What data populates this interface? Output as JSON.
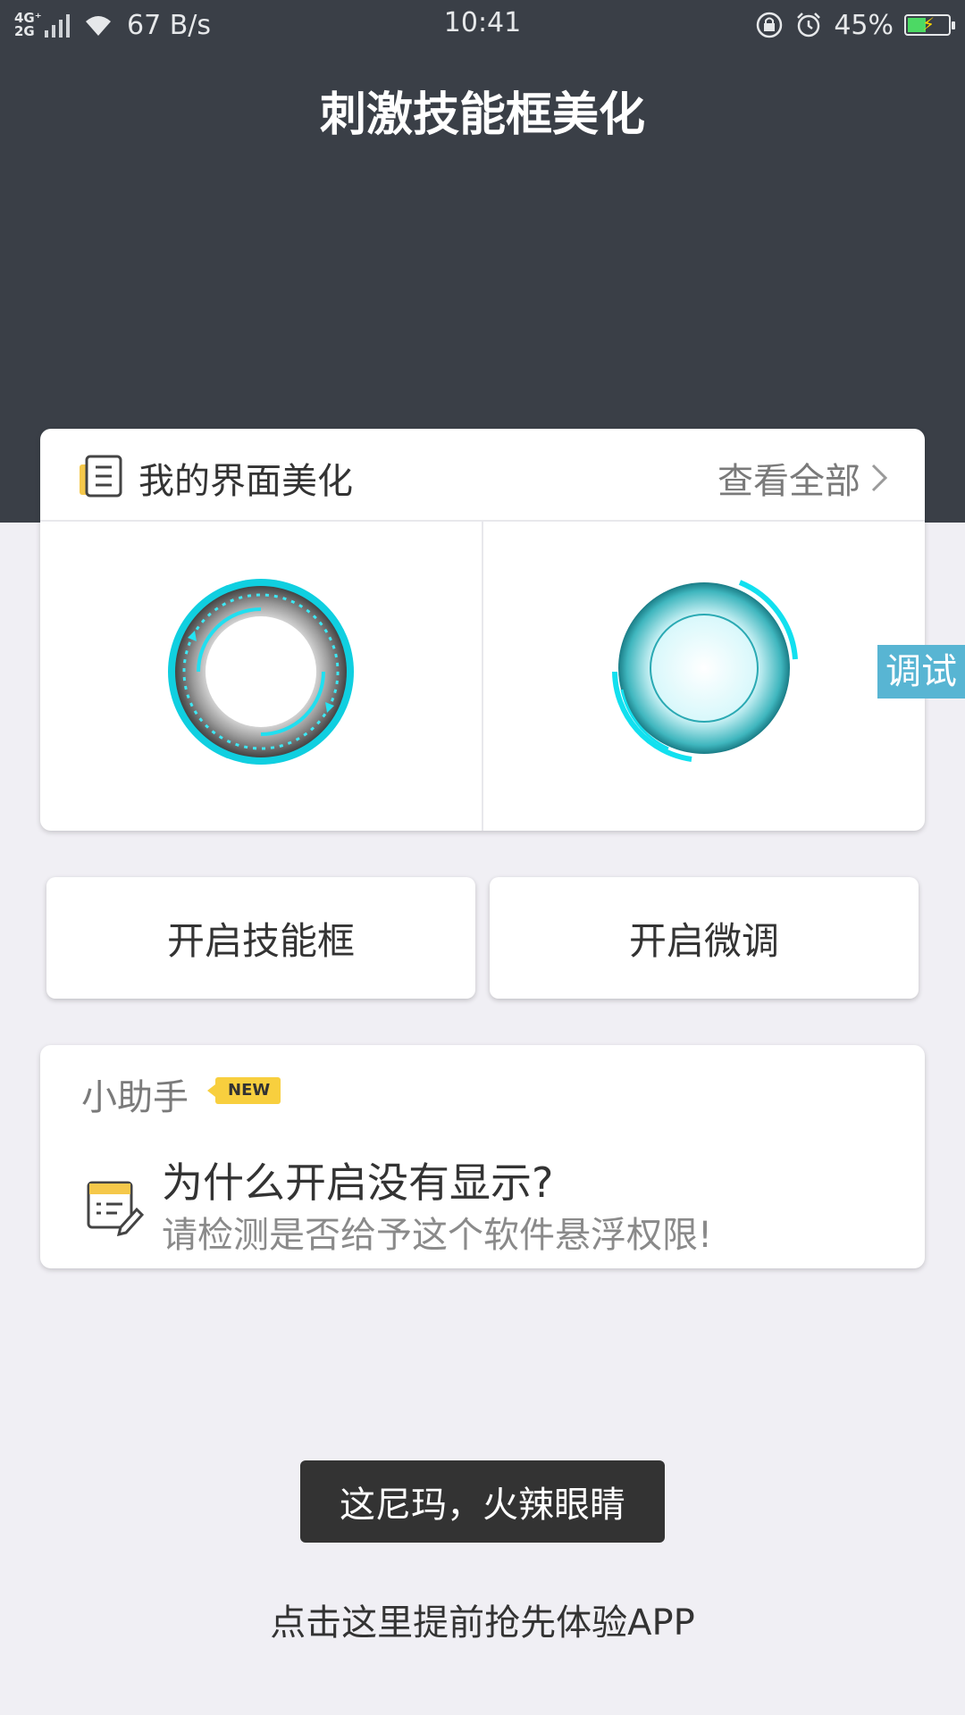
{
  "status_bar": {
    "network_type": "4G⁺\n2G",
    "speed": "67 B/s",
    "time": "10:41",
    "battery_percent": "45%",
    "battery_level": 0.45,
    "icons": [
      "signal-icon",
      "wifi-icon",
      "lock-rotation-icon",
      "alarm-icon",
      "battery-icon"
    ]
  },
  "header": {
    "title": "刺激技能框美化",
    "background": "#3a3f47"
  },
  "my_ui_card": {
    "title": "我的界面美化",
    "view_all": "查看全部",
    "thumbnails": [
      "skill-frame-ring-1",
      "skill-frame-ring-2"
    ]
  },
  "debug_tab": {
    "label": "调试",
    "color": "#58b5d3"
  },
  "buttons": {
    "open_skill_frame": "开启技能框",
    "open_fine_tune": "开启微调"
  },
  "helper_card": {
    "title": "小助手",
    "badge": "NEW",
    "question": "为什么开启没有显示?",
    "answer": "请检测是否给予这个软件悬浮权限!"
  },
  "toast": {
    "text": "这尼玛，火辣眼睛"
  },
  "bottom_link": {
    "text": "点击这里提前抢先体验APP"
  },
  "colors": {
    "accent_cyan": "#1de2ee",
    "badge_yellow": "#f8cf3e"
  }
}
